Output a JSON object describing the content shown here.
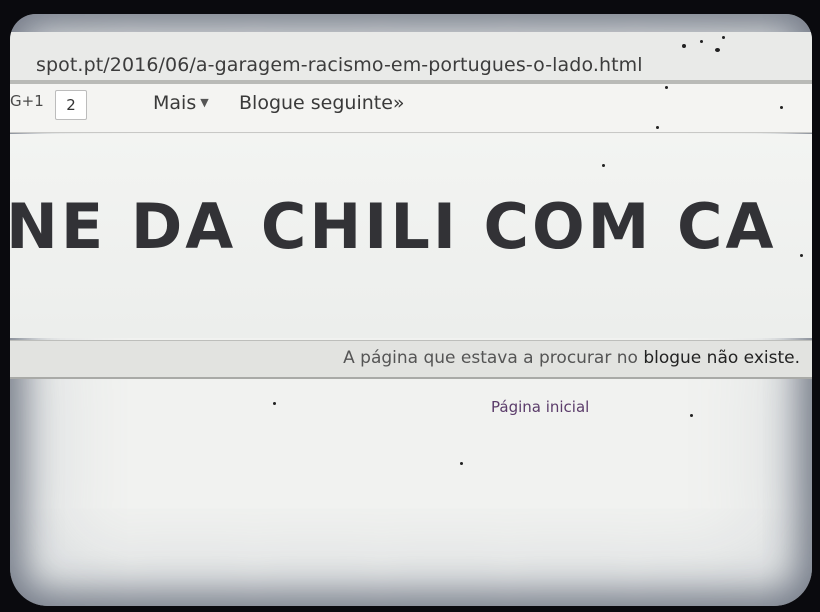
{
  "browser": {
    "url": "spot.pt/2016/06/a-garagem-racismo-em-portugues-o-lado.html"
  },
  "navbar": {
    "gplus_label": "G+1",
    "gplus_count": "2",
    "more_label": "Mais",
    "next_blog_label": "Blogue seguinte»"
  },
  "blog": {
    "title": "NE DA CHILI COM CA"
  },
  "status": {
    "message_prefix": "A página que estava a procurar no",
    "message_suffix": "blogue não existe."
  },
  "links": {
    "home": "Página inicial"
  }
}
